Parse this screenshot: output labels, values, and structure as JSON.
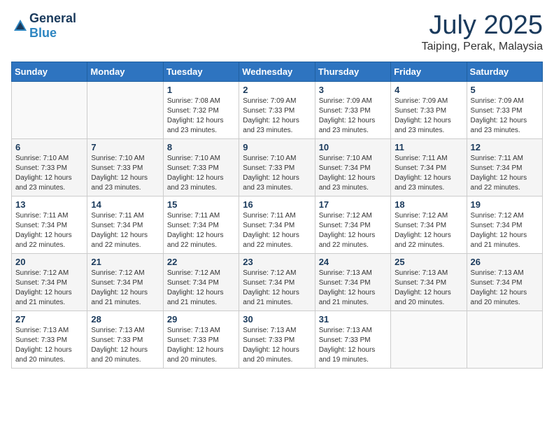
{
  "header": {
    "logo_general": "General",
    "logo_blue": "Blue",
    "month": "July 2025",
    "location": "Taiping, Perak, Malaysia"
  },
  "weekdays": [
    "Sunday",
    "Monday",
    "Tuesday",
    "Wednesday",
    "Thursday",
    "Friday",
    "Saturday"
  ],
  "weeks": [
    [
      {
        "day": "",
        "info": ""
      },
      {
        "day": "",
        "info": ""
      },
      {
        "day": "1",
        "info": "Sunrise: 7:08 AM\nSunset: 7:32 PM\nDaylight: 12 hours and 23 minutes."
      },
      {
        "day": "2",
        "info": "Sunrise: 7:09 AM\nSunset: 7:33 PM\nDaylight: 12 hours and 23 minutes."
      },
      {
        "day": "3",
        "info": "Sunrise: 7:09 AM\nSunset: 7:33 PM\nDaylight: 12 hours and 23 minutes."
      },
      {
        "day": "4",
        "info": "Sunrise: 7:09 AM\nSunset: 7:33 PM\nDaylight: 12 hours and 23 minutes."
      },
      {
        "day": "5",
        "info": "Sunrise: 7:09 AM\nSunset: 7:33 PM\nDaylight: 12 hours and 23 minutes."
      }
    ],
    [
      {
        "day": "6",
        "info": "Sunrise: 7:10 AM\nSunset: 7:33 PM\nDaylight: 12 hours and 23 minutes."
      },
      {
        "day": "7",
        "info": "Sunrise: 7:10 AM\nSunset: 7:33 PM\nDaylight: 12 hours and 23 minutes."
      },
      {
        "day": "8",
        "info": "Sunrise: 7:10 AM\nSunset: 7:33 PM\nDaylight: 12 hours and 23 minutes."
      },
      {
        "day": "9",
        "info": "Sunrise: 7:10 AM\nSunset: 7:33 PM\nDaylight: 12 hours and 23 minutes."
      },
      {
        "day": "10",
        "info": "Sunrise: 7:10 AM\nSunset: 7:34 PM\nDaylight: 12 hours and 23 minutes."
      },
      {
        "day": "11",
        "info": "Sunrise: 7:11 AM\nSunset: 7:34 PM\nDaylight: 12 hours and 23 minutes."
      },
      {
        "day": "12",
        "info": "Sunrise: 7:11 AM\nSunset: 7:34 PM\nDaylight: 12 hours and 22 minutes."
      }
    ],
    [
      {
        "day": "13",
        "info": "Sunrise: 7:11 AM\nSunset: 7:34 PM\nDaylight: 12 hours and 22 minutes."
      },
      {
        "day": "14",
        "info": "Sunrise: 7:11 AM\nSunset: 7:34 PM\nDaylight: 12 hours and 22 minutes."
      },
      {
        "day": "15",
        "info": "Sunrise: 7:11 AM\nSunset: 7:34 PM\nDaylight: 12 hours and 22 minutes."
      },
      {
        "day": "16",
        "info": "Sunrise: 7:11 AM\nSunset: 7:34 PM\nDaylight: 12 hours and 22 minutes."
      },
      {
        "day": "17",
        "info": "Sunrise: 7:12 AM\nSunset: 7:34 PM\nDaylight: 12 hours and 22 minutes."
      },
      {
        "day": "18",
        "info": "Sunrise: 7:12 AM\nSunset: 7:34 PM\nDaylight: 12 hours and 22 minutes."
      },
      {
        "day": "19",
        "info": "Sunrise: 7:12 AM\nSunset: 7:34 PM\nDaylight: 12 hours and 21 minutes."
      }
    ],
    [
      {
        "day": "20",
        "info": "Sunrise: 7:12 AM\nSunset: 7:34 PM\nDaylight: 12 hours and 21 minutes."
      },
      {
        "day": "21",
        "info": "Sunrise: 7:12 AM\nSunset: 7:34 PM\nDaylight: 12 hours and 21 minutes."
      },
      {
        "day": "22",
        "info": "Sunrise: 7:12 AM\nSunset: 7:34 PM\nDaylight: 12 hours and 21 minutes."
      },
      {
        "day": "23",
        "info": "Sunrise: 7:12 AM\nSunset: 7:34 PM\nDaylight: 12 hours and 21 minutes."
      },
      {
        "day": "24",
        "info": "Sunrise: 7:13 AM\nSunset: 7:34 PM\nDaylight: 12 hours and 21 minutes."
      },
      {
        "day": "25",
        "info": "Sunrise: 7:13 AM\nSunset: 7:34 PM\nDaylight: 12 hours and 20 minutes."
      },
      {
        "day": "26",
        "info": "Sunrise: 7:13 AM\nSunset: 7:34 PM\nDaylight: 12 hours and 20 minutes."
      }
    ],
    [
      {
        "day": "27",
        "info": "Sunrise: 7:13 AM\nSunset: 7:33 PM\nDaylight: 12 hours and 20 minutes."
      },
      {
        "day": "28",
        "info": "Sunrise: 7:13 AM\nSunset: 7:33 PM\nDaylight: 12 hours and 20 minutes."
      },
      {
        "day": "29",
        "info": "Sunrise: 7:13 AM\nSunset: 7:33 PM\nDaylight: 12 hours and 20 minutes."
      },
      {
        "day": "30",
        "info": "Sunrise: 7:13 AM\nSunset: 7:33 PM\nDaylight: 12 hours and 20 minutes."
      },
      {
        "day": "31",
        "info": "Sunrise: 7:13 AM\nSunset: 7:33 PM\nDaylight: 12 hours and 19 minutes."
      },
      {
        "day": "",
        "info": ""
      },
      {
        "day": "",
        "info": ""
      }
    ]
  ]
}
